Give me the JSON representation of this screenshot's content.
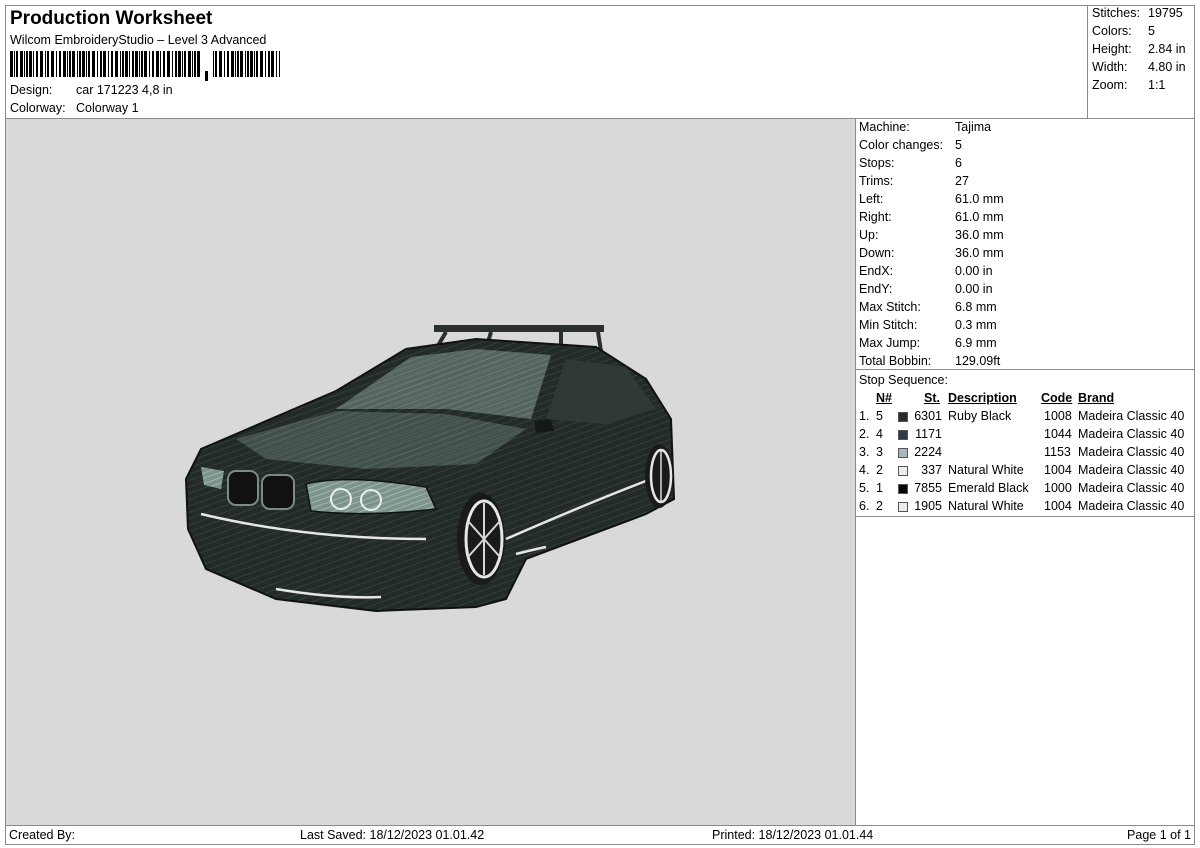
{
  "header": {
    "title": "Production Worksheet",
    "software": "Wilcom EmbroideryStudio – Level 3 Advanced",
    "design_label": "Design:",
    "design_value": "car 171223 4,8 in",
    "colorway_label": "Colorway:",
    "colorway_value": "Colorway 1"
  },
  "summary": [
    {
      "label": "Stitches:",
      "value": "19795"
    },
    {
      "label": "Colors:",
      "value": "5"
    },
    {
      "label": "Height:",
      "value": "2.84 in"
    },
    {
      "label": "Width:",
      "value": "4.80 in"
    },
    {
      "label": "Zoom:",
      "value": "1:1"
    }
  ],
  "machine_info": [
    {
      "label": "Machine:",
      "value": "Tajima"
    },
    {
      "label": "Color changes:",
      "value": "5"
    },
    {
      "label": "Stops:",
      "value": "6"
    },
    {
      "label": "Trims:",
      "value": "27"
    },
    {
      "label": "Left:",
      "value": "61.0 mm"
    },
    {
      "label": "Right:",
      "value": "61.0 mm"
    },
    {
      "label": "Up:",
      "value": "36.0 mm"
    },
    {
      "label": "Down:",
      "value": "36.0 mm"
    },
    {
      "label": "EndX:",
      "value": "0.00 in"
    },
    {
      "label": "EndY:",
      "value": "0.00 in"
    },
    {
      "label": "Max Stitch:",
      "value": "6.8 mm"
    },
    {
      "label": "Min Stitch:",
      "value": "0.3 mm"
    },
    {
      "label": "Max Jump:",
      "value": "6.9 mm"
    },
    {
      "label": "Total Bobbin:",
      "value": "129.09ft"
    }
  ],
  "stop_sequence": {
    "label": "Stop Sequence:",
    "columns": {
      "n": "N#",
      "st": "St.",
      "description": "Description",
      "code": "Code",
      "brand": "Brand"
    },
    "rows": [
      {
        "index": "1.",
        "n": "5",
        "color": "#2b2b2b",
        "st": "6301",
        "description": "Ruby Black",
        "code": "1008",
        "brand": "Madeira Classic 40"
      },
      {
        "index": "2.",
        "n": "4",
        "color": "#2f3a44",
        "st": "1171",
        "description": "",
        "code": "1044",
        "brand": "Madeira Classic 40"
      },
      {
        "index": "3.",
        "n": "3",
        "color": "#a9b7bf",
        "st": "2224",
        "description": "",
        "code": "1153",
        "brand": "Madeira Classic 40"
      },
      {
        "index": "4.",
        "n": "2",
        "color": "#ececec",
        "st": "337",
        "description": "Natural White",
        "code": "1004",
        "brand": "Madeira Classic 40"
      },
      {
        "index": "5.",
        "n": "1",
        "color": "#050505",
        "st": "7855",
        "description": "Emerald Black",
        "code": "1000",
        "brand": "Madeira Classic 40"
      },
      {
        "index": "6.",
        "n": "2",
        "color": "#ececec",
        "st": "1905",
        "description": "Natural White",
        "code": "1004",
        "brand": "Madeira Classic 40"
      }
    ]
  },
  "footer": {
    "created_by": "Created By:",
    "last_saved": "Last Saved: 18/12/2023 01.01.42",
    "printed": "Printed: 18/12/2023 01.01.44",
    "page": "Page 1 of 1"
  },
  "design_preview": {
    "background": "#d9d9d9",
    "car_body": "#1f2723",
    "car_highlight": "#a9c2b8",
    "trim": "#e6e6e6"
  }
}
